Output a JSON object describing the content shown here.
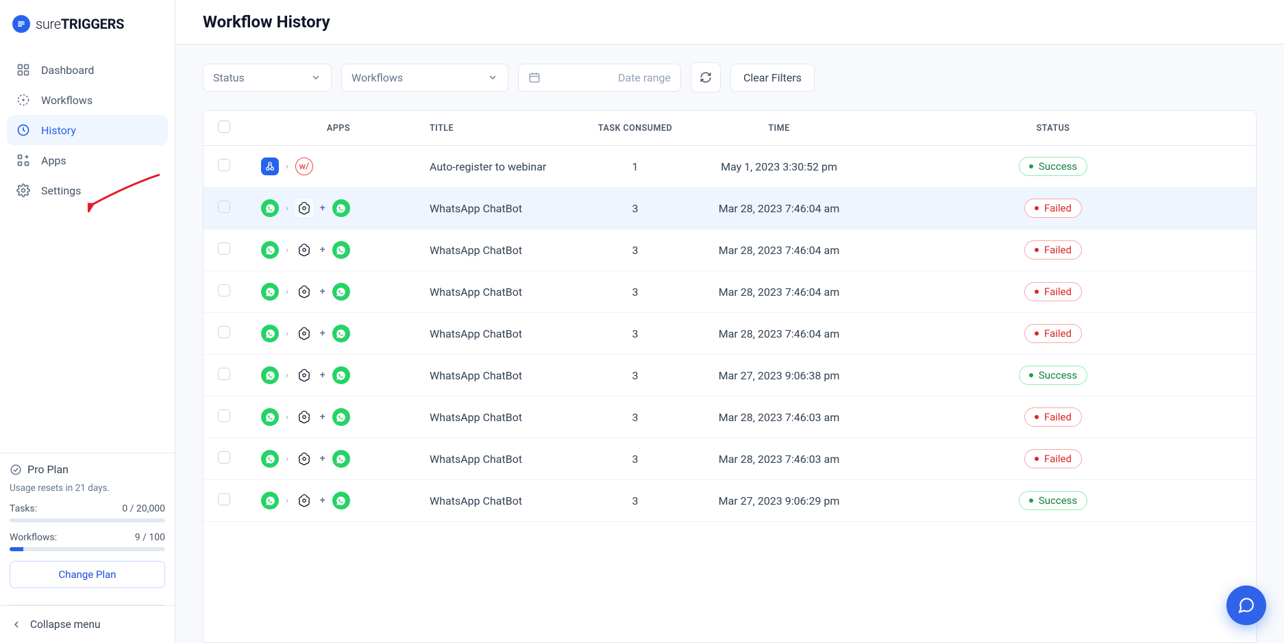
{
  "brand": {
    "thin": "sure",
    "bold": "TRIGGERS"
  },
  "nav": {
    "dashboard": "Dashboard",
    "workflows": "Workflows",
    "history": "History",
    "apps": "Apps",
    "settings": "Settings"
  },
  "plan": {
    "name": "Pro Plan",
    "reset": "Usage resets in 21 days.",
    "tasks_label": "Tasks:",
    "tasks_value": "0 / 20,000",
    "tasks_pct": 0,
    "workflows_label": "Workflows:",
    "workflows_value": "9 / 100",
    "workflows_pct": 9,
    "change_plan": "Change Plan"
  },
  "collapse": "Collapse menu",
  "page_title": "Workflow History",
  "filters": {
    "status": "Status",
    "workflows": "Workflows",
    "daterange": "Date range",
    "clear": "Clear Filters"
  },
  "table": {
    "headers": {
      "apps": "APPS",
      "title": "TITLE",
      "task": "TASK CONSUMED",
      "time": "TIME",
      "status": "STATUS"
    },
    "rows": [
      {
        "apps": "webhook-webinar",
        "title": "Auto-register to webinar",
        "task": "1",
        "time": "May 1, 2023 3:30:52 pm",
        "status": "Success"
      },
      {
        "apps": "wa-openai-wa",
        "title": "WhatsApp ChatBot",
        "task": "3",
        "time": "Mar 28, 2023 7:46:04 am",
        "status": "Failed",
        "hovered": true
      },
      {
        "apps": "wa-openai-wa",
        "title": "WhatsApp ChatBot",
        "task": "3",
        "time": "Mar 28, 2023 7:46:04 am",
        "status": "Failed"
      },
      {
        "apps": "wa-openai-wa",
        "title": "WhatsApp ChatBot",
        "task": "3",
        "time": "Mar 28, 2023 7:46:04 am",
        "status": "Failed"
      },
      {
        "apps": "wa-openai-wa",
        "title": "WhatsApp ChatBot",
        "task": "3",
        "time": "Mar 28, 2023 7:46:04 am",
        "status": "Failed"
      },
      {
        "apps": "wa-openai-wa",
        "title": "WhatsApp ChatBot",
        "task": "3",
        "time": "Mar 27, 2023 9:06:38 pm",
        "status": "Success"
      },
      {
        "apps": "wa-openai-wa",
        "title": "WhatsApp ChatBot",
        "task": "3",
        "time": "Mar 28, 2023 7:46:03 am",
        "status": "Failed"
      },
      {
        "apps": "wa-openai-wa",
        "title": "WhatsApp ChatBot",
        "task": "3",
        "time": "Mar 28, 2023 7:46:03 am",
        "status": "Failed"
      },
      {
        "apps": "wa-openai-wa",
        "title": "WhatsApp ChatBot",
        "task": "3",
        "time": "Mar 27, 2023 9:06:29 pm",
        "status": "Success"
      }
    ]
  },
  "badge": {
    "success": "Success",
    "failed": "Failed"
  }
}
